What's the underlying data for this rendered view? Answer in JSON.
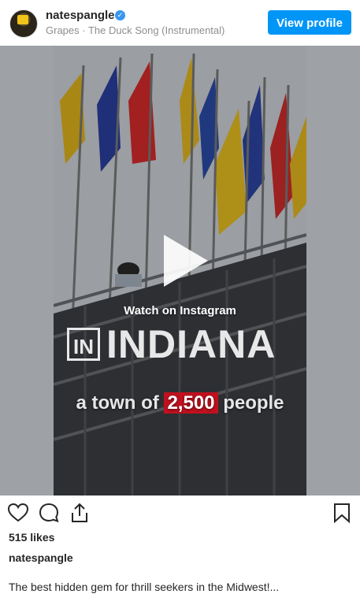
{
  "header": {
    "username": "natespangle",
    "song": "Grapes · The Duck Song (Instrumental)",
    "view_profile": "View profile"
  },
  "video": {
    "watch_label": "Watch on Instagram",
    "brand": "INDIANA",
    "brand_mark": "IN",
    "town_prefix": "a town of",
    "town_number": "2,500",
    "town_suffix": "people"
  },
  "footer": {
    "likes": "515 likes",
    "owner": "natespangle",
    "caption": "The best hidden gem for thrill seekers in the Midwest!..."
  },
  "colors": {
    "accent": "#0095f6",
    "verified": "#3897f0",
    "highlight": "#c0111f"
  },
  "icons": [
    "verified-badge-icon",
    "play-icon",
    "heart-icon",
    "comment-icon",
    "share-icon",
    "bookmark-icon"
  ]
}
